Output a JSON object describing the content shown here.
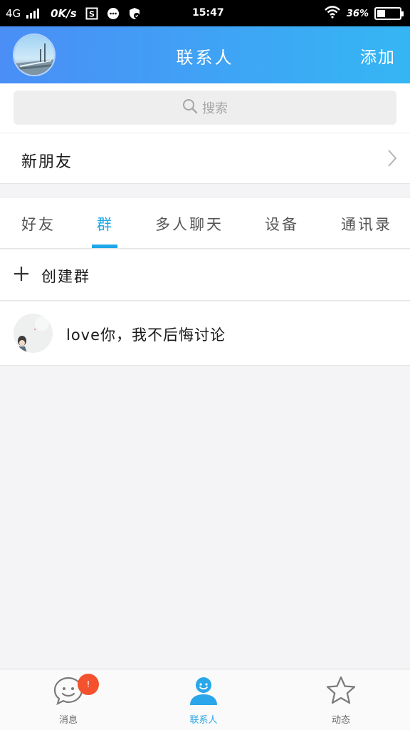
{
  "status_bar": {
    "network": "4G",
    "speed": "0K/s",
    "time": "15:47",
    "battery": "36%"
  },
  "header": {
    "title": "联系人",
    "add_label": "添加"
  },
  "search": {
    "placeholder": "搜索"
  },
  "new_friend": {
    "label": "新朋友"
  },
  "tabs": [
    {
      "label": "好友",
      "active": false
    },
    {
      "label": "群",
      "active": true
    },
    {
      "label": "多人聊天",
      "active": false
    },
    {
      "label": "设备",
      "active": false
    },
    {
      "label": "通讯录",
      "active": false
    }
  ],
  "create_group": {
    "label": "创建群"
  },
  "groups": [
    {
      "name": "love你，我不后悔讨论"
    }
  ],
  "bottom_nav": [
    {
      "label": "消息",
      "icon": "message-icon",
      "badge": "!",
      "active": false
    },
    {
      "label": "联系人",
      "icon": "contact-icon",
      "active": true
    },
    {
      "label": "动态",
      "icon": "star-icon",
      "active": false
    }
  ],
  "colors": {
    "accent": "#1ea6e8",
    "header_start": "#4a8ef6",
    "header_end": "#35b6f4",
    "badge": "#f4522e"
  },
  "battery_level": 0.36
}
